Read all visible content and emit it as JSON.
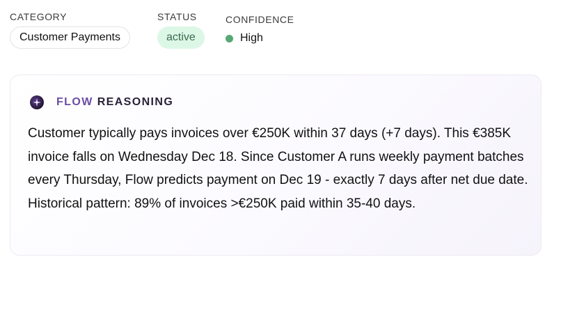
{
  "category": {
    "label": "CATEGORY",
    "value": "Customer Payments"
  },
  "status": {
    "label": "STATUS",
    "value": "active",
    "color": "#dcf7e6"
  },
  "confidence": {
    "label": "CONFIDENCE",
    "value": "High",
    "dot_color": "#56a874"
  },
  "reasoning": {
    "title_part1": "FLOW",
    "title_part2": "REASONING",
    "icon": "flow-sparkle-icon",
    "body": "Customer typically pays invoices over €250K within 37 days (+7 days). This €385K invoice falls on Wednesday Dec 18. Since Customer A runs weekly payment batches every Thursday, Flow predicts payment on Dec 19 - exactly 7 days after net due date. Historical pattern: 89% of invoices >€250K paid within 35-40 days."
  }
}
